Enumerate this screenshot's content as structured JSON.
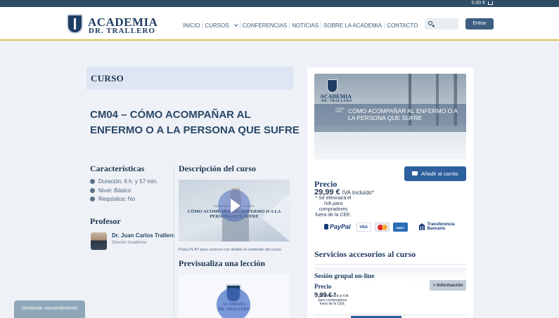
{
  "header": {
    "cart_total": "0,00 €",
    "logo_line1": "ACADEMIA",
    "logo_line2": "DR. TRALLERO",
    "nav": [
      "INICIO",
      "CURSOS",
      "CONFERENCIAS",
      "NOTICIAS",
      "SOBRE LA ACADEMIA",
      "CONTACTO"
    ],
    "search_placeholder": "",
    "login_label": "Entrar"
  },
  "course": {
    "section_label": "CURSO",
    "title": "CM04 – CÓMO ACOMPAÑAR AL ENFERMO O A LA PERSONA QUE SUFRE"
  },
  "characteristics": {
    "heading": "Características",
    "duration": "Duración: 6 h. y 57 min.",
    "level": "Nivel: Básico",
    "requirements": "Requisitos: No"
  },
  "professor": {
    "heading": "Profesor",
    "name": "Dr. Juan Carlos Trallero",
    "role": "Director Academia"
  },
  "description": {
    "heading": "Descripción del curso",
    "video_kicker": "DESARROLLO DEL CURSO",
    "video_title": "CÓMO ACOMPAÑAR AL ENFERMO O A LA PERSONA QUE SUFRE",
    "caption": "Pulsa PLAY para conocer con detalle el contenido del curso."
  },
  "preview": {
    "heading": "Previsualiza una lección",
    "logo_line1": "ACADEMIA",
    "logo_line2": "DR. TRALLERO"
  },
  "purchase": {
    "image_logo_line1": "ACADEMIA",
    "image_logo_line2": "DR. TRALLERO",
    "image_kicker": "CURSO CM04",
    "image_title": "CÓMO ACOMPAÑAR AL ENFERMO O A LA PERSONA QUE SUFRE",
    "add_to_cart": "Añadir al carrito",
    "price_label": "Precio",
    "price": "29,99 €",
    "price_tax": "IVA Incluído*",
    "price_note": "* Se eliminará el IVA para compradores fuera de la CEE.",
    "payment": {
      "paypal": "PayPal",
      "visa": "VISA",
      "amex": "AMEX",
      "bank_line1": "Transferencia",
      "bank_line2": "Bancaria"
    }
  },
  "services": {
    "heading": "Servicios accesorios al curso",
    "item_name": "Sesión grupal on-line",
    "price_label": "Precio",
    "price": "9,99 € *",
    "note": "* Se eliminará el IVA para compradores fuera de la CEE.",
    "info_button": "+ Información"
  },
  "consent": {
    "label": "Gestionar consentimiento"
  }
}
